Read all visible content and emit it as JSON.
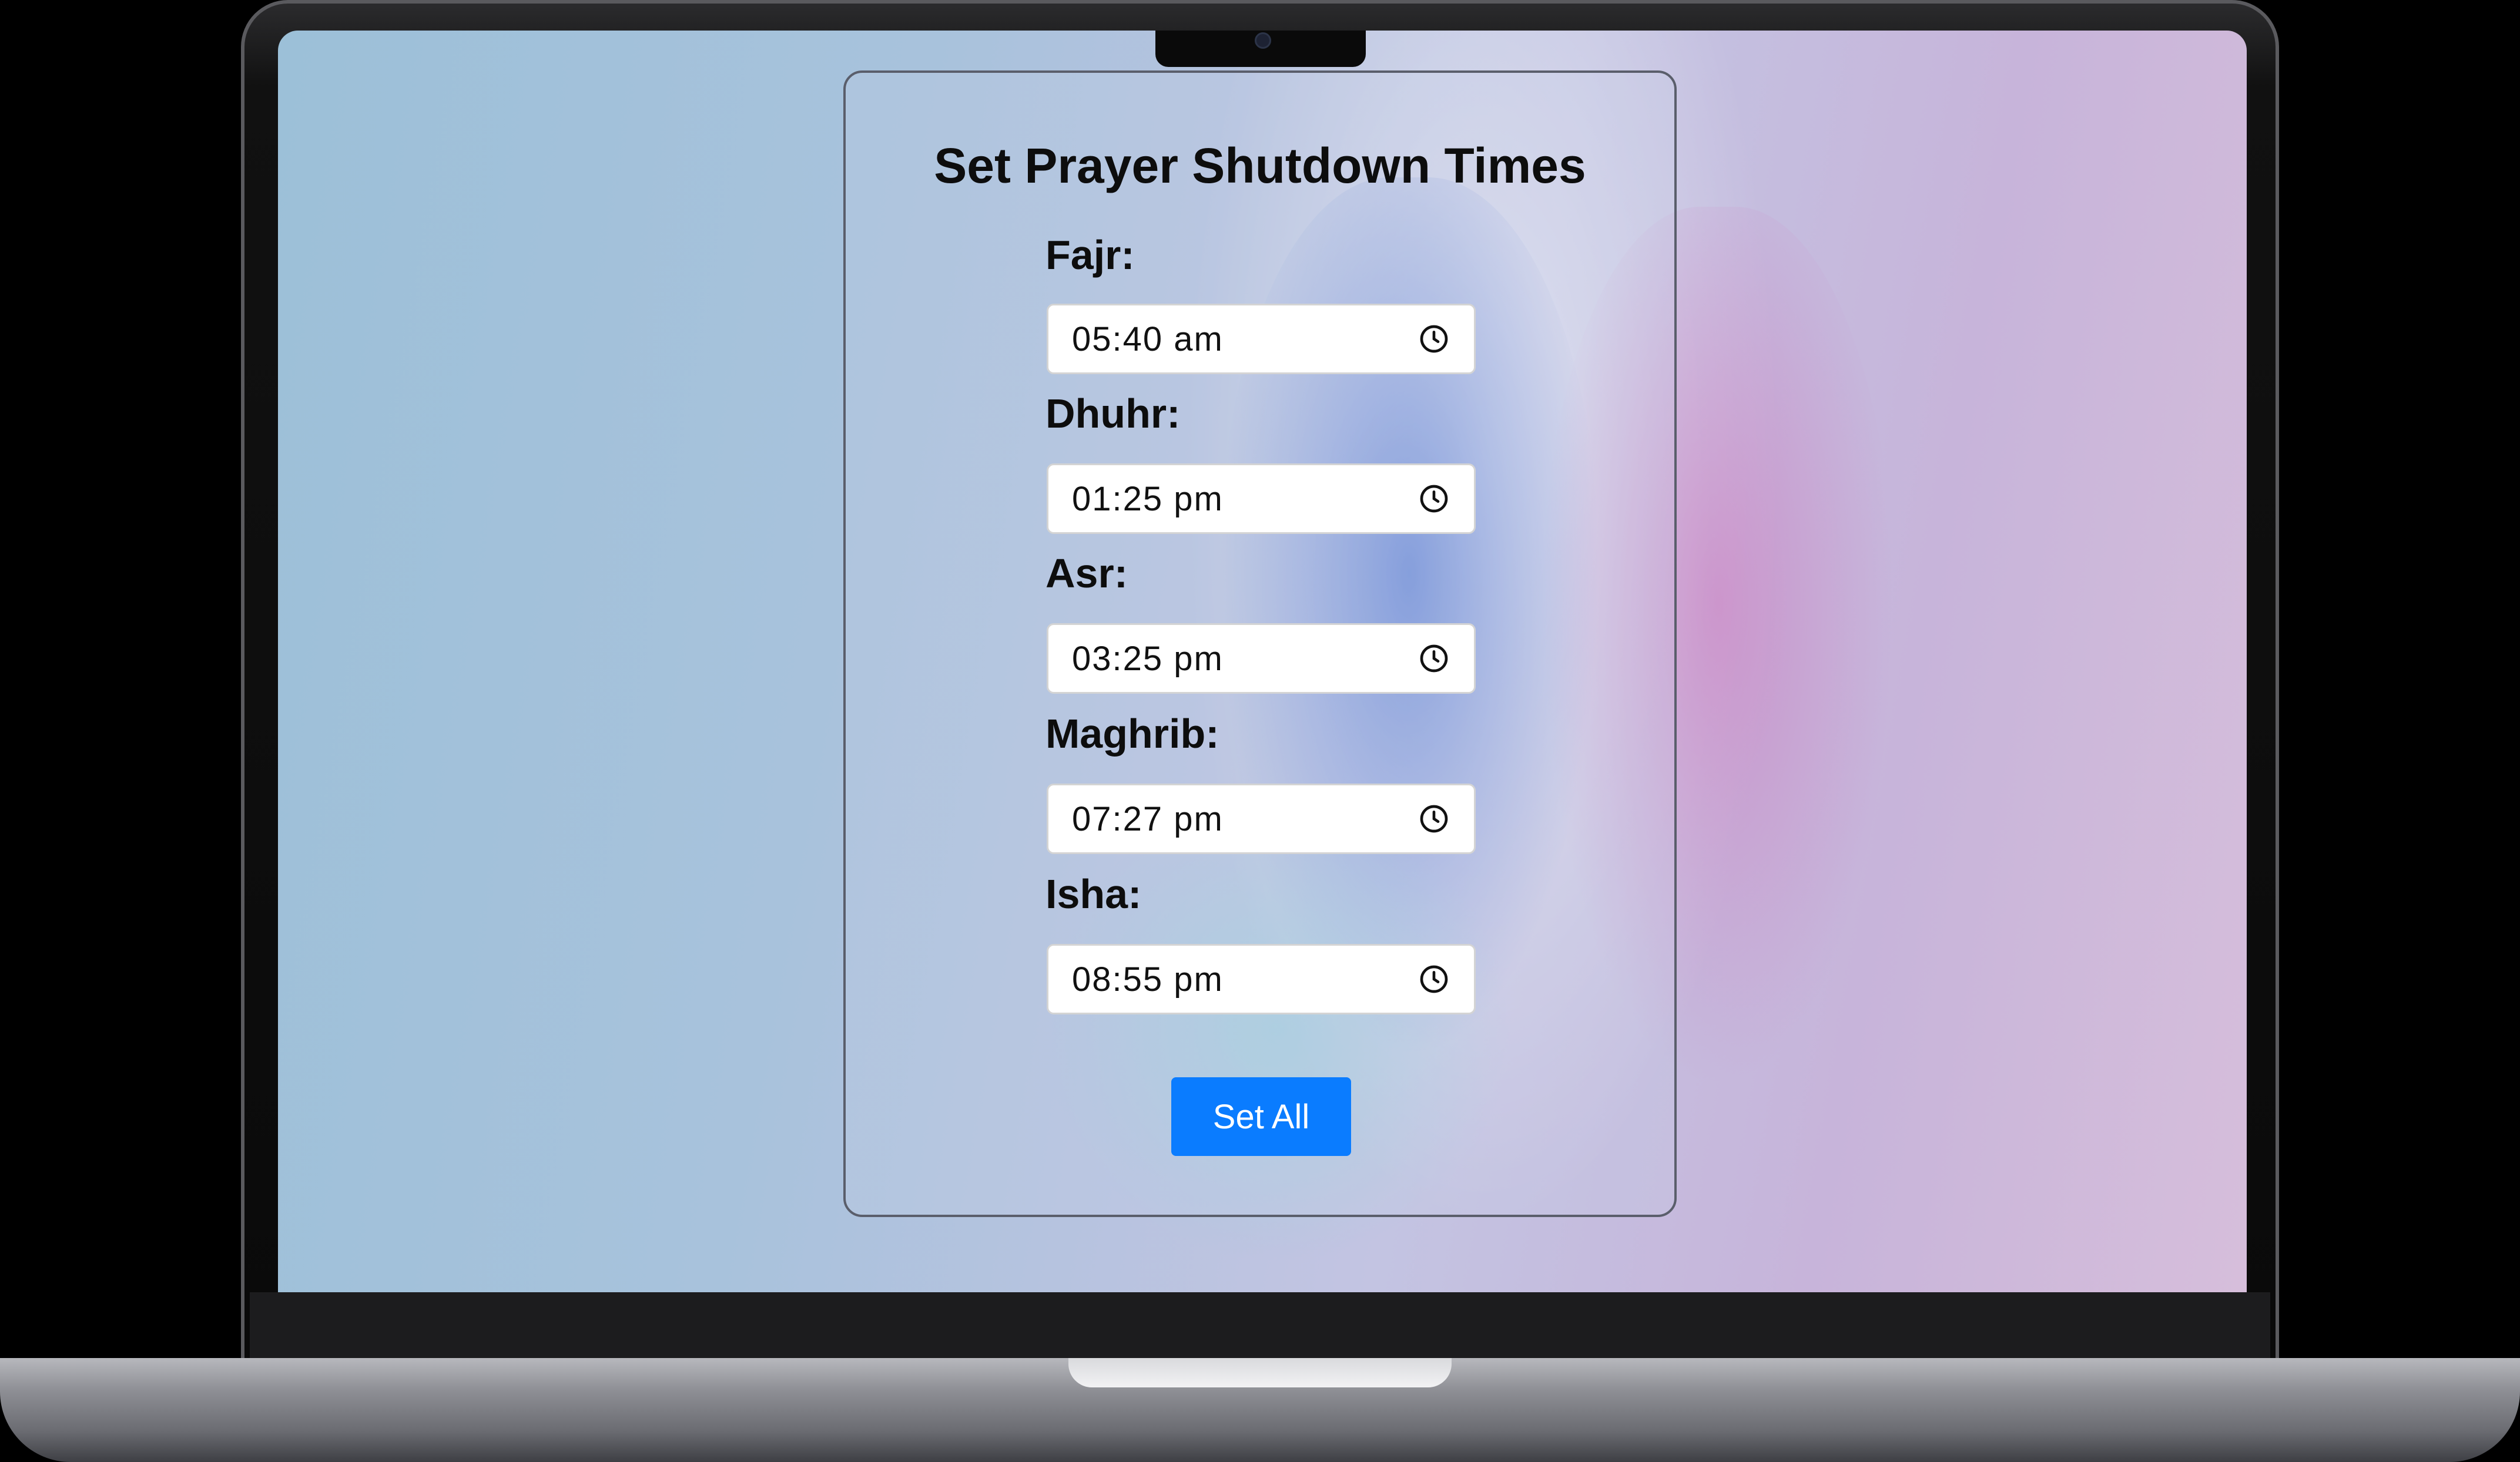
{
  "panel": {
    "title": "Set Prayer Shutdown Times"
  },
  "prayers": [
    {
      "label": "Fajr:",
      "value": "05:40 am"
    },
    {
      "label": "Dhuhr:",
      "value": "01:25 pm"
    },
    {
      "label": "Asr:",
      "value": "03:25 pm"
    },
    {
      "label": "Maghrib:",
      "value": "07:27 pm"
    },
    {
      "label": "Isha:",
      "value": "08:55 pm"
    }
  ],
  "actions": {
    "set_all_label": "Set All"
  },
  "icons": {
    "time_picker": "clock-icon"
  },
  "colors": {
    "accent": "#0a7cff",
    "panel_border": "#5a5e6b",
    "text": "#0d0d0d"
  }
}
